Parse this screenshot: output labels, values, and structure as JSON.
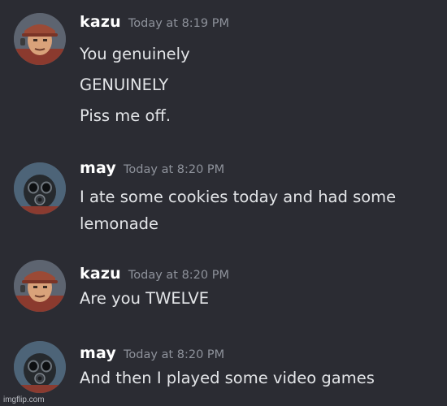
{
  "messages": [
    {
      "user": "kazu",
      "time": "Today at 8:19 PM",
      "avatar_icon": "scout-avatar",
      "lines": [
        "You genuinely",
        "GENUINELY",
        "Piss me off."
      ]
    },
    {
      "user": "may",
      "time": "Today at 8:20 PM",
      "avatar_icon": "pyro-avatar",
      "lines": [
        "I ate some cookies today and had some",
        "lemonade"
      ]
    },
    {
      "user": "kazu",
      "time": "Today at 8:20 PM",
      "avatar_icon": "scout-avatar",
      "lines": [
        "Are you TWELVE"
      ]
    },
    {
      "user": "may",
      "time": "Today at 8:20 PM",
      "avatar_icon": "pyro-avatar",
      "lines": [
        "And then I played some video games"
      ]
    }
  ],
  "watermark": "imgflip.com",
  "colors": {
    "background": "#2b2c33",
    "username": "#ffffff",
    "timestamp": "#8e929b",
    "message_text": "#e3e5e8"
  }
}
